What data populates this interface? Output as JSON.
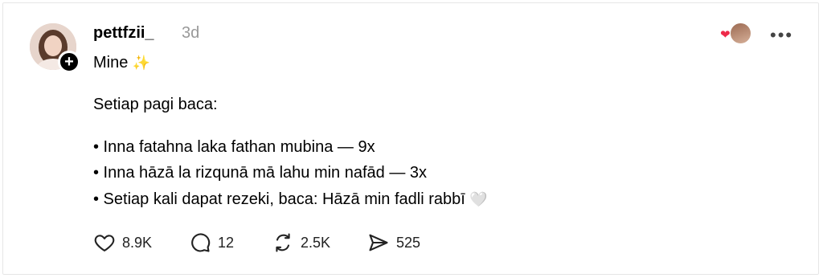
{
  "post": {
    "username": "pettfzii_",
    "time_ago": "3d",
    "caption": "Mine",
    "caption_emoji": "✨",
    "lines": [
      "Setiap pagi baca:",
      "• Inna fatahna laka fathan mubina — 9x",
      "• Inna hāzā la rizqunā mā lahu min nafād — 3x",
      "• Setiap kali dapat rezeki, baca: Hāzā min fadli rabbī"
    ],
    "line3_emoji": "🤍",
    "follow_icon": "+",
    "more_icon": "•••"
  },
  "actions": {
    "likes": "8.9K",
    "replies": "12",
    "reposts": "2.5K",
    "shares": "525"
  },
  "icons": {
    "like": "heart-outline-icon",
    "reply": "speech-bubble-icon",
    "repost": "repost-arrows-icon",
    "share": "paper-plane-icon",
    "more": "more-options-icon"
  }
}
